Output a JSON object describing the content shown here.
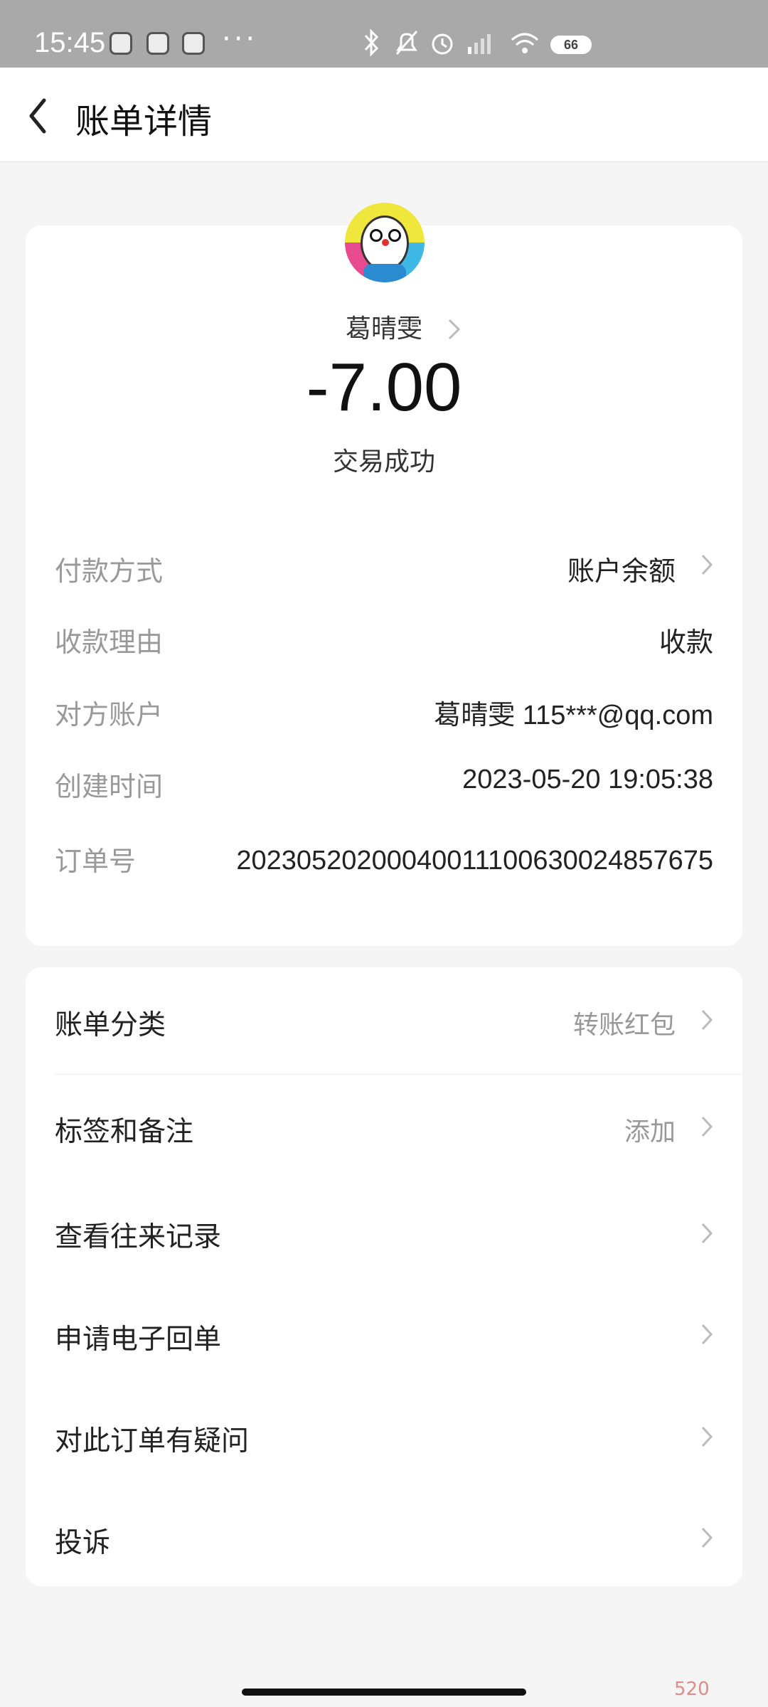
{
  "status_bar": {
    "time": "15:45",
    "dots": "···",
    "battery": "66",
    "icons": [
      "bluetooth-icon",
      "silent-icon",
      "alarm-icon",
      "signal-icon",
      "wifi-icon",
      "battery-icon"
    ]
  },
  "header": {
    "title": "账单详情"
  },
  "transaction": {
    "payee": "葛晴雯",
    "amount": "-7.00",
    "status": "交易成功"
  },
  "details": [
    {
      "label": "付款方式",
      "value": "账户余额"
    },
    {
      "label": "收款理由",
      "value": "收款"
    },
    {
      "label": "对方账户",
      "value": "葛晴雯 115***@qq.com"
    },
    {
      "label": "创建时间",
      "value": "2023-05-20 19:05:38"
    },
    {
      "label": "订单号",
      "value": "20230520200040011100630024857675"
    }
  ],
  "menu": [
    {
      "label": "账单分类",
      "value": "转账红包"
    },
    {
      "label": "标签和备注",
      "value": "添加"
    },
    {
      "label": "查看往来记录",
      "value": ""
    },
    {
      "label": "申请电子回单",
      "value": ""
    },
    {
      "label": "对此订单有疑问",
      "value": ""
    },
    {
      "label": "投诉",
      "value": ""
    }
  ],
  "watermark": "520",
  "colors": {
    "accent_text": "#222222",
    "muted_text": "#999999",
    "background": "#f5f5f5"
  }
}
